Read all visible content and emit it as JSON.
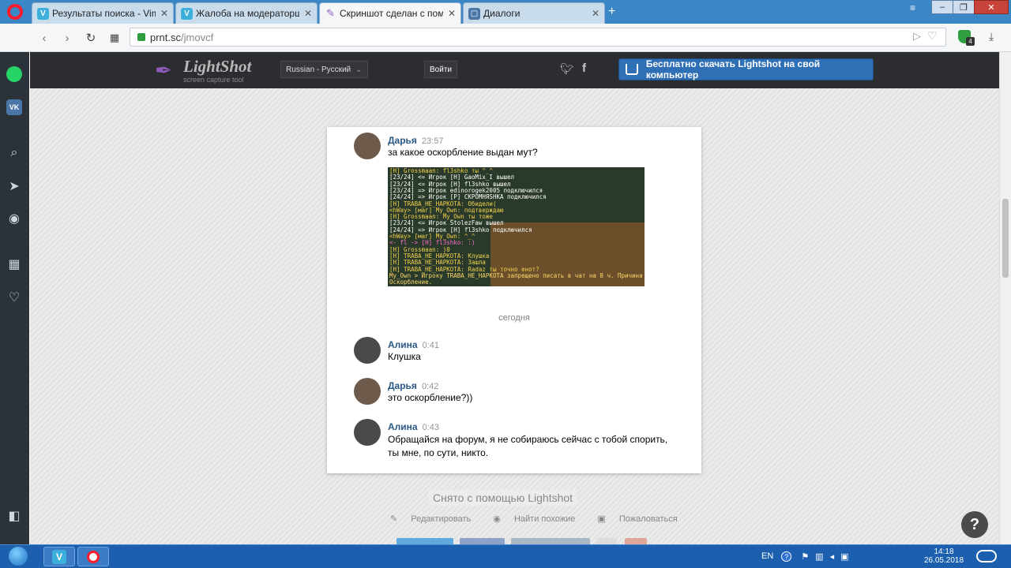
{
  "tabs": [
    {
      "title": "Результаты поиска - Vime",
      "favicon": "V",
      "color": "#3cb0da"
    },
    {
      "title": "Жалоба на модераторшу",
      "favicon": "V",
      "color": "#3cb0da"
    },
    {
      "title": "Скриншот сделан с помо",
      "favicon": "feather",
      "color": "#8e5bb8"
    },
    {
      "title": "Диалоги",
      "favicon": "chat",
      "color": "#4a76a8"
    }
  ],
  "address": {
    "host": "prnt.sc",
    "path": "/jmovcf"
  },
  "extension_badge": "4",
  "lightshot": {
    "logo_title": "LightShot",
    "logo_subtitle": "screen capture tool",
    "language": "Russian - Русский",
    "login": "Войти",
    "download": "Бесплатно скачать Lightshot на свой компьютер"
  },
  "messages": [
    {
      "name": "Дарья",
      "time": "23:57",
      "text": "за какое оскорбление выдан мут?"
    },
    {
      "name": "Алина",
      "time": "0:41",
      "text": "Клушка"
    },
    {
      "name": "Дарья",
      "time": "0:42",
      "text": "это оскорбление?))"
    },
    {
      "name": "Алина",
      "time": "0:43",
      "text": "Обращайся на форум, я не собираюсь сейчас с тобой спорить,",
      "text2": "ты мне, по сути, никто."
    }
  ],
  "chat_screenshot_lines": [
    {
      "text": "[Н] Grossmaan: fl3shko ты ^_^",
      "color": "#f1d04a"
    },
    {
      "text": "[23/24] <= Игрок [Н] GaoMix_I вышел",
      "color": "#ffffff"
    },
    {
      "text": "[23/24] <= Игрок [Н] fl3shko вышел",
      "color": "#ffffff"
    },
    {
      "text": "[23/24] => Игрок edinorogek2005 подключился",
      "color": "#ffffff"
    },
    {
      "text": "[24/24] => Игрок [Р] СКРОМНЯSHKA подключился",
      "color": "#ffffff"
    },
    {
      "text": "[Н] TRABA_HE_HAPKOTA: Обидели(",
      "color": "#f1d04a"
    },
    {
      "text": "<hWay> [маг] My_Own: подтверждаю",
      "color": "#f1d04a"
    },
    {
      "text": "[Н] Grossmaan: My_Own ты тоже",
      "color": "#f1d04a"
    },
    {
      "text": "[23/24] <= Игрок StolezFaw вышел",
      "color": "#ffffff"
    },
    {
      "text": "[24/24] => Игрок [Н] fl3shko подключился",
      "color": "#ffffff"
    },
    {
      "text": "<hWay> [маг] My_Own: ^_^",
      "color": "#f1d04a"
    },
    {
      "text": "<- fl -> [Н] fl3shko: :)",
      "color": "#ff6fd0"
    },
    {
      "text": "[Н] Grossmaan: )0",
      "color": "#f1d04a"
    },
    {
      "text": "[Н] TRABA_HE_HAPKOTA: Клушка",
      "color": "#f1d04a"
    },
    {
      "text": "[Н] TRABA_HE_HAPKOTA: Зашла",
      "color": "#f1d04a"
    },
    {
      "text": "[Н] TRABA_HE_HAPKOTA: Radaz ты точно енот?",
      "color": "#f1d04a"
    },
    {
      "text": "My_Own > Игроку TRABA_HE_HAPKOTA запрещено писать в чат на 8 ч. Причина",
      "color": "#ffd86a"
    },
    {
      "text": "Оскорбление.",
      "color": "#ffd86a"
    }
  ],
  "date_separator": "сегодня",
  "via": "Снято с помощью Lightshot",
  "actions": {
    "edit": "Редактировать",
    "similar": "Найти похожие",
    "report": "Пожаловаться"
  },
  "help": "?",
  "tray": {
    "lang": "EN",
    "time": "14:18",
    "date": "26.05.2018"
  }
}
